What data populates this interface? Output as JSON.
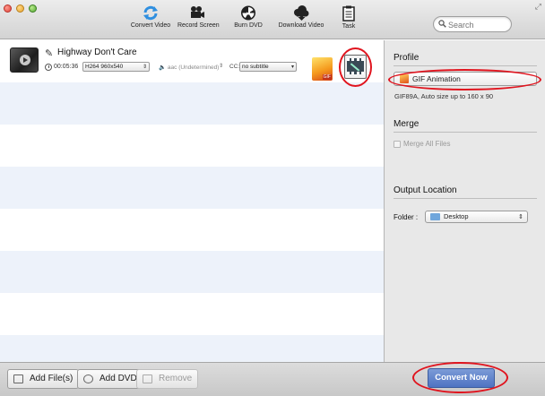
{
  "toolbar": {
    "items": [
      {
        "label": "Convert Video",
        "icon": "convert-arrows-icon"
      },
      {
        "label": "Record Screen",
        "icon": "video-camera-icon"
      },
      {
        "label": "Burn DVD",
        "icon": "radiation-disc-icon"
      },
      {
        "label": "Download Video",
        "icon": "cloud-download-icon"
      },
      {
        "label": "Task",
        "icon": "clipboard-icon"
      }
    ],
    "search_placeholder": "Search"
  },
  "file": {
    "title": "Highway Don't Care",
    "duration": "00:05:36",
    "video_track": "H264 960x540",
    "audio_track": "aac (Undetermined)",
    "subtitle_prefix": "CC:",
    "subtitle": "no subtitle",
    "format_badge": "GIF"
  },
  "panel": {
    "profile_heading": "Profile",
    "profile_value": "GIF Animation",
    "profile_desc": "GIF89A, Auto size up to 160 x 90",
    "merge_heading": "Merge",
    "merge_label": "Merge All Files",
    "merge_checked": false,
    "output_heading": "Output Location",
    "folder_label": "Folder :",
    "folder_value": "Desktop"
  },
  "bottom": {
    "add_files": "Add File(s)",
    "add_dvd": "Add DVD",
    "remove": "Remove",
    "convert_now": "Convert Now"
  },
  "colors": {
    "annotation_red": "#e0141e",
    "convert_blue": "#4f73c2",
    "stripe_blue": "#edf2fa"
  }
}
